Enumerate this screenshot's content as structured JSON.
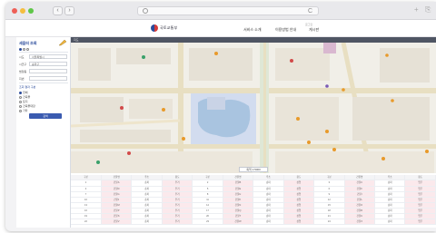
{
  "browser": {
    "back": "‹",
    "forward": "›",
    "search_icon": "search-icon",
    "reload": "C",
    "right_plus": "+",
    "right_icon": "⎘"
  },
  "site": {
    "logo_text": "국토교통부",
    "nav": [
      "서비스 소개",
      "이용방법 안내",
      "게시판"
    ],
    "nav_top": "로그인"
  },
  "sidebar": {
    "title": "세움터 조회",
    "filters": [
      {
        "label": "시도",
        "value": "서울특별시"
      },
      {
        "label": "시군구",
        "value": "송파구"
      },
      {
        "label": "법정동",
        "value": ""
      },
      {
        "label": "지번",
        "value": ""
      }
    ],
    "section_title": "조회 결과 구분",
    "options": [
      "전체",
      "건축물",
      "토지",
      "건축물대장",
      "기타"
    ],
    "button": "검색"
  },
  "map": {
    "topbar": "지도",
    "scale_label": "축척 1:5000"
  },
  "colors": {
    "accent": "#2a4b9b",
    "button": "#3b5bb0",
    "map_bg": "#f1efe8",
    "water": "#a9c4e0",
    "road": "#e8dfc2",
    "table_pink": "#fbe9ec"
  },
  "table": {
    "headers": [
      "구분",
      "건물명",
      "주소",
      "용도",
      "구분",
      "건물명",
      "주소",
      "용도",
      "구분",
      "건물명",
      "주소",
      "용도"
    ],
    "rows": [
      [
        "1",
        "건물A",
        "송파",
        "주거",
        "2",
        "건물B",
        "송파",
        "상업",
        "3",
        "건물C",
        "송파",
        "업무"
      ],
      [
        "4",
        "건물D",
        "송파",
        "주거",
        "5",
        "건물E",
        "송파",
        "상업",
        "6",
        "건물F",
        "송파",
        "업무"
      ],
      [
        "7",
        "건물G",
        "송파",
        "주거",
        "8",
        "건물H",
        "송파",
        "상업",
        "9",
        "건물I",
        "송파",
        "업무"
      ],
      [
        "10",
        "건물J",
        "송파",
        "주거",
        "11",
        "건물K",
        "송파",
        "상업",
        "12",
        "건물L",
        "송파",
        "업무"
      ],
      [
        "13",
        "건물M",
        "송파",
        "주거",
        "14",
        "건물N",
        "송파",
        "상업",
        "15",
        "건물O",
        "송파",
        "업무"
      ],
      [
        "16",
        "건물P",
        "송파",
        "주거",
        "17",
        "건물Q",
        "송파",
        "상업",
        "18",
        "건물R",
        "송파",
        "업무"
      ],
      [
        "19",
        "건물S",
        "송파",
        "주거",
        "20",
        "건물T",
        "송파",
        "상업",
        "21",
        "건물U",
        "송파",
        "업무"
      ],
      [
        "22",
        "건물V",
        "송파",
        "주거",
        "23",
        "건물W",
        "송파",
        "상업",
        "24",
        "건물X",
        "송파",
        "업무"
      ]
    ]
  }
}
